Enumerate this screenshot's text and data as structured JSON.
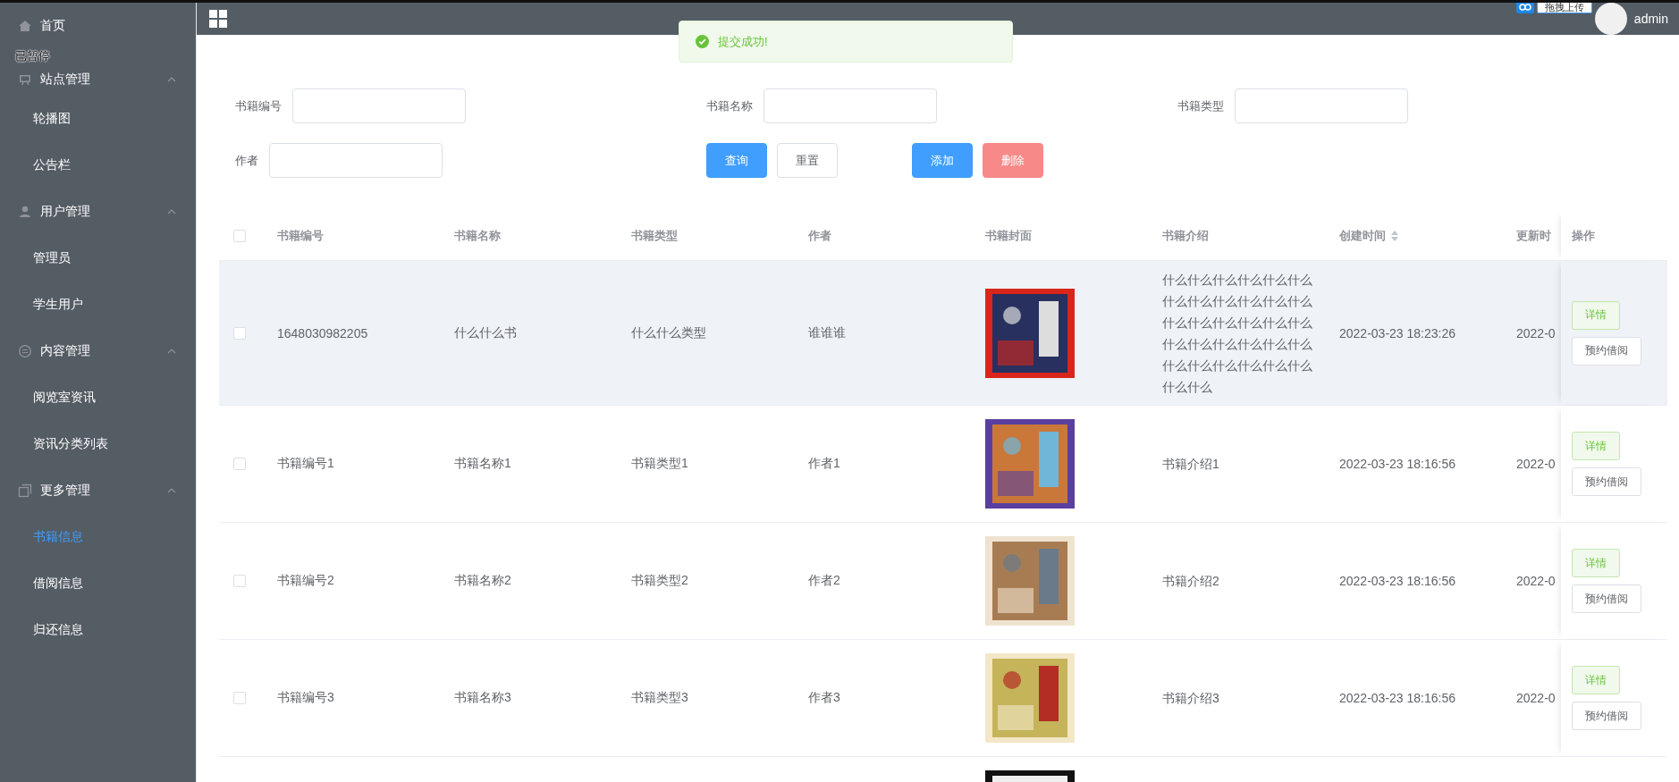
{
  "overlay_badge": "已暂停",
  "upload_badge": "拖拽上传",
  "sidebar": {
    "items": [
      {
        "kind": "link",
        "label": "首页",
        "selected": false
      },
      {
        "kind": "group",
        "label": "站点管理",
        "expanded": true,
        "children": [
          {
            "label": "轮播图",
            "selected": false
          },
          {
            "label": "公告栏",
            "selected": false
          }
        ]
      },
      {
        "kind": "group",
        "label": "用户管理",
        "expanded": true,
        "children": [
          {
            "label": "管理员",
            "selected": false
          },
          {
            "label": "学生用户",
            "selected": false
          }
        ]
      },
      {
        "kind": "group",
        "label": "内容管理",
        "expanded": true,
        "children": [
          {
            "label": "阅览室资讯",
            "selected": false
          },
          {
            "label": "资讯分类列表",
            "selected": false
          }
        ]
      },
      {
        "kind": "group",
        "label": "更多管理",
        "expanded": true,
        "children": [
          {
            "label": "书籍信息",
            "selected": true
          },
          {
            "label": "借阅信息",
            "selected": false
          },
          {
            "label": "归还信息",
            "selected": false
          }
        ]
      }
    ]
  },
  "topbar": {
    "user": "admin"
  },
  "toast": {
    "message": "提交成功!"
  },
  "filters": {
    "fields": [
      {
        "label": "书籍编号"
      },
      {
        "label": "书籍名称"
      },
      {
        "label": "书籍类型"
      },
      {
        "label": "作者"
      }
    ],
    "buttons": [
      {
        "label": "查询",
        "kind": "primary"
      },
      {
        "label": "重置",
        "kind": "default"
      },
      {
        "label": "添加",
        "kind": "primary"
      },
      {
        "label": "删除",
        "kind": "danger"
      }
    ]
  },
  "table": {
    "all_checked": false,
    "columns": [
      {
        "label": "书籍编号"
      },
      {
        "label": "书籍名称"
      },
      {
        "label": "书籍类型"
      },
      {
        "label": "作者"
      },
      {
        "label": "书籍封面"
      },
      {
        "label": "书籍介绍"
      },
      {
        "label": "创建时间",
        "sortable": true
      },
      {
        "label": "更新时"
      },
      {
        "label": "操作"
      }
    ],
    "rows": [
      {
        "hovered": true,
        "checked": false,
        "cells": [
          "1648030982205",
          "什么什么书",
          "什么什么类型",
          "谁谁谁"
        ],
        "cover": {
          "kind": "picture"
        },
        "intro": "什么什么什么什么什么什么什么什么什么什么什么什么什么什么什么什么什么什么什么什么什么什么什么什么什么什么什么什么什么什么什么什么",
        "created": "2022-03-23 18:23:26",
        "updated": "2022-0",
        "actions": [
          {
            "label": "详情",
            "kind": "success"
          },
          {
            "label": "预约借阅",
            "kind": "default"
          }
        ]
      },
      {
        "hovered": false,
        "checked": false,
        "cells": [
          "书籍编号1",
          "书籍名称1",
          "书籍类型1",
          "作者1"
        ],
        "cover": {
          "kind": "picture"
        },
        "intro": "书籍介绍1",
        "created": "2022-03-23 18:16:56",
        "updated": "2022-0",
        "actions": [
          {
            "label": "详情",
            "kind": "success"
          },
          {
            "label": "预约借阅",
            "kind": "default"
          }
        ]
      },
      {
        "hovered": false,
        "checked": false,
        "cells": [
          "书籍编号2",
          "书籍名称2",
          "书籍类型2",
          "作者2"
        ],
        "cover": {
          "kind": "picture"
        },
        "intro": "书籍介绍2",
        "created": "2022-03-23 18:16:56",
        "updated": "2022-0",
        "actions": [
          {
            "label": "详情",
            "kind": "success"
          },
          {
            "label": "预约借阅",
            "kind": "default"
          }
        ]
      },
      {
        "hovered": false,
        "checked": false,
        "cells": [
          "书籍编号3",
          "书籍名称3",
          "书籍类型3",
          "作者3"
        ],
        "cover": {
          "kind": "picture"
        },
        "intro": "书籍介绍3",
        "created": "2022-03-23 18:16:56",
        "updated": "2022-0",
        "actions": [
          {
            "label": "详情",
            "kind": "success"
          },
          {
            "label": "预约借阅",
            "kind": "default"
          }
        ]
      },
      {
        "hovered": false,
        "cover": {
          "kind": "picture"
        }
      }
    ]
  }
}
